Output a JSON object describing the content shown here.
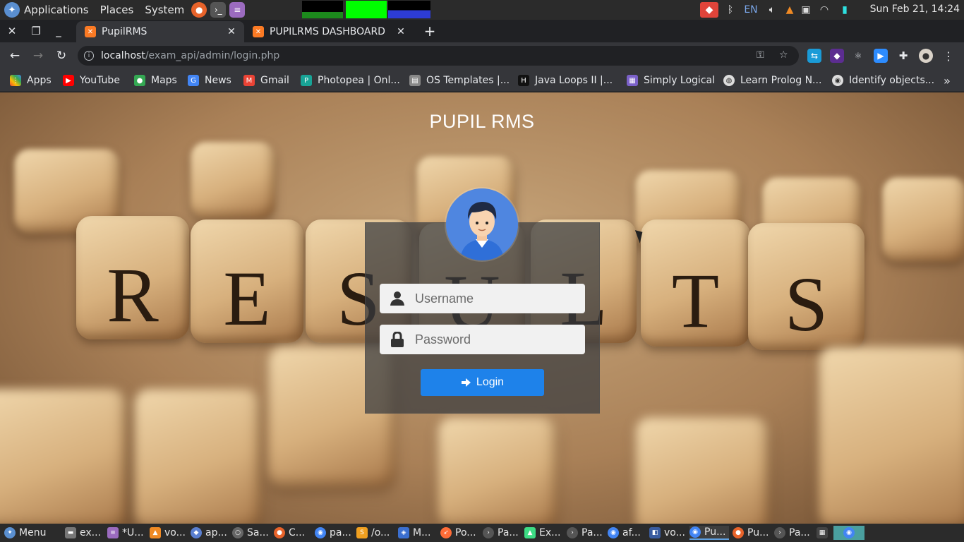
{
  "top_panel": {
    "menus": [
      "Applications",
      "Places",
      "System"
    ],
    "clock": "Sun Feb 21, 14:24",
    "keyboard_layout": "EN"
  },
  "tabs": [
    {
      "title": "PupilRMS",
      "active": true
    },
    {
      "title": "PUPILRMS DASHBOARD",
      "active": false
    }
  ],
  "toolbar": {
    "url_host": "localhost",
    "url_path": "/exam_api/admin/login.php"
  },
  "bookmarks": [
    {
      "label": "Apps",
      "icon": "apps-grid-icon"
    },
    {
      "label": "YouTube",
      "icon": "youtube-icon"
    },
    {
      "label": "Maps",
      "icon": "maps-icon"
    },
    {
      "label": "News",
      "icon": "news-icon"
    },
    {
      "label": "Gmail",
      "icon": "gmail-icon"
    },
    {
      "label": "Photopea | Onl...",
      "icon": "photopea-icon"
    },
    {
      "label": "OS Templates |...",
      "icon": "os-templates-icon"
    },
    {
      "label": "Java Loops II |...",
      "icon": "hackerrank-icon"
    },
    {
      "label": "Simply Logical",
      "icon": "simply-logical-icon"
    },
    {
      "label": "Learn Prolog N...",
      "icon": "globe-icon"
    },
    {
      "label": "Identify objects...",
      "icon": "identify-icon"
    }
  ],
  "page": {
    "title": "PUPIL RMS",
    "background_letters": [
      "R",
      "E",
      "S",
      "U",
      "L",
      "T",
      "S"
    ],
    "username_placeholder": "Username",
    "password_placeholder": "Password",
    "login_label": "Login",
    "accent": "#1e82ea"
  },
  "taskbar": {
    "menu_label": "Menu",
    "items": [
      "ex...",
      "*U...",
      "vo...",
      "ap...",
      "Sa...",
      "C...",
      "pa...",
      "/o...",
      "M...",
      "Po...",
      "Pa...",
      "Ex...",
      "Pa...",
      "af...",
      "vo...",
      "Pu...",
      "Pu...",
      "Pa..."
    ]
  }
}
